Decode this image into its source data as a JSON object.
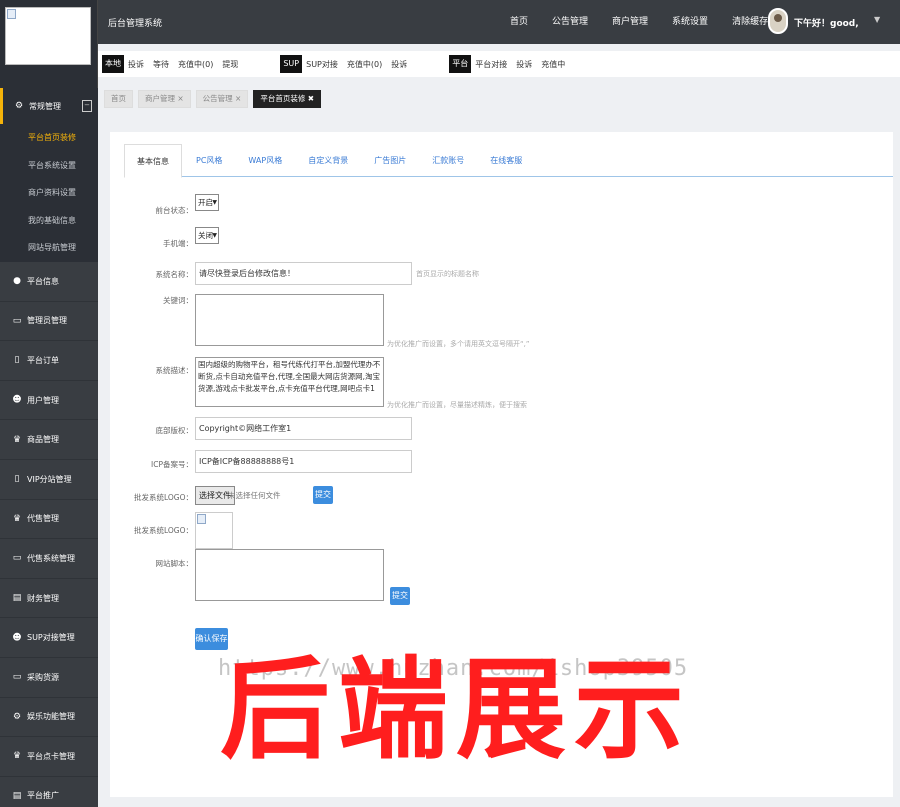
{
  "header": {
    "app_title": "后台管理系统",
    "nav": [
      "首页",
      "公告管理",
      "商户管理",
      "系统设置",
      "清除缓存"
    ],
    "greeting": "下午好！good,",
    "user_caret": "▼"
  },
  "quickbar": {
    "groups": [
      {
        "tag": "本地",
        "links": [
          "投诉",
          "等待",
          "充值中(0)",
          "提现"
        ]
      },
      {
        "tag": "SUP",
        "links": [
          "SUP对接",
          "充值中(0)",
          "投诉"
        ]
      },
      {
        "tag": "平台",
        "links": [
          "平台对接",
          "投诉",
          "充值中"
        ]
      }
    ]
  },
  "sidebar": {
    "active_group": "常规管理",
    "submenu": [
      "平台首页装修",
      "平台系统设置",
      "商户资料设置",
      "我的基础信息",
      "网站导航管理"
    ],
    "items": [
      {
        "label": "平台信息",
        "icon": "pin-icon"
      },
      {
        "label": "管理员管理",
        "icon": "monitor-icon"
      },
      {
        "label": "平台订单",
        "icon": "document-icon"
      },
      {
        "label": "用户管理",
        "icon": "user-icon"
      },
      {
        "label": "商品管理",
        "icon": "cup-icon"
      },
      {
        "label": "VIP分站管理",
        "icon": "document-icon"
      },
      {
        "label": "代售管理",
        "icon": "cup-icon"
      },
      {
        "label": "代售系统管理",
        "icon": "monitor-icon"
      },
      {
        "label": "财务管理",
        "icon": "wallet-icon"
      },
      {
        "label": "SUP对接管理",
        "icon": "user-icon"
      },
      {
        "label": "采购货源",
        "icon": "monitor-icon"
      },
      {
        "label": "娱乐功能管理",
        "icon": "gear-icon"
      },
      {
        "label": "平台点卡管理",
        "icon": "cup-icon"
      },
      {
        "label": "平台推广",
        "icon": "wallet-icon"
      }
    ]
  },
  "breadcrumbs": [
    "首页",
    "商户管理 ×",
    "公告管理 ×",
    "平台首页装修 ✖"
  ],
  "tabs": [
    "基本信息",
    "PC风格",
    "WAP风格",
    "自定义背景",
    "广告图片",
    "汇款账号",
    "在线客服"
  ],
  "form": {
    "status_label": "前台状态：",
    "status_value": "开启",
    "mobile_label": "手机端：",
    "mobile_value": "关闭",
    "site_name_label": "系统名称：",
    "site_name_value": "请尽快登录后台修改信息！",
    "site_name_hint": "首页显示的标题名称",
    "keywords_label": "关键词：",
    "keywords_value": "",
    "keywords_hint": "为优化推广而设置，多个请用英文逗号隔开“,”",
    "desc_label": "系统描述：",
    "desc_value": "国内超级的购物平台，租号代练代打平台,加盟代理办不断货,点卡自动充值平台,代理,全国最大网店货源网,淘宝货源,游戏点卡批发平台,点卡充值平台代理,网吧点卡1",
    "desc_hint": "为优化推广而设置，尽量描述精炼，便于搜索",
    "copyright_label": "底部版权：",
    "copyright_value": "Copyright©网络工作室1",
    "icp_label": "ICP备案号：",
    "icp_value": "ICP备ICP备88888888号1",
    "logo_upload_label": "批发系统LOGO：",
    "choose_file": "选择文件",
    "no_file": "未选择任何文件",
    "upload_btn": "提交",
    "logo_preview_label": "批发系统LOGO：",
    "script_label": "网站脚本：",
    "script_value": "",
    "script_submit": "提交",
    "save_btn": "确认保存"
  },
  "overlay": {
    "watermark": "https://www.huzhan.com/ishop39505",
    "banner": "后端展示"
  }
}
